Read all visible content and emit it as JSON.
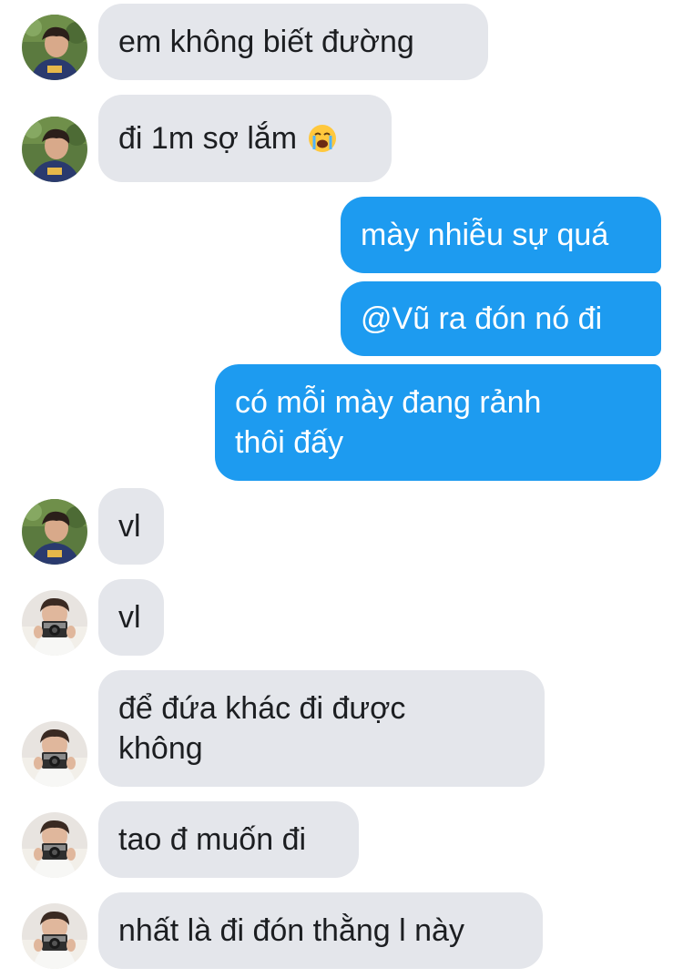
{
  "messages": [
    {
      "text": "em không biết đường",
      "sender": "friend-a"
    },
    {
      "text": "đi 1m sợ lắm",
      "emoji": "loudly-crying-face",
      "sender": "friend-a"
    },
    {
      "text": "mày nhiễu sự quá",
      "sender": "me"
    },
    {
      "text": "@Vũ ra đón nó đi",
      "sender": "me"
    },
    {
      "text": "có mỗi mày đang rảnh thôi đấy",
      "sender": "me"
    },
    {
      "text": "vl",
      "sender": "friend-a"
    },
    {
      "text": "vl",
      "sender": "friend-b"
    },
    {
      "text": "để đứa khác đi được không",
      "sender": "friend-b"
    },
    {
      "text": "tao đ muốn đi",
      "sender": "friend-b"
    },
    {
      "text": "nhất là đi đón thằng l này",
      "sender": "friend-b"
    }
  ],
  "colors": {
    "incoming_bubble": "#e4e6eb",
    "outgoing_bubble": "#1d9bf0",
    "incoming_text": "#1c1e21",
    "outgoing_text": "#ffffff"
  },
  "icons": {
    "friend_a_avatar": "avatar-photo-boy-profile",
    "friend_b_avatar": "avatar-photo-person-with-camera",
    "emoji": "loudly-crying-face-icon"
  }
}
